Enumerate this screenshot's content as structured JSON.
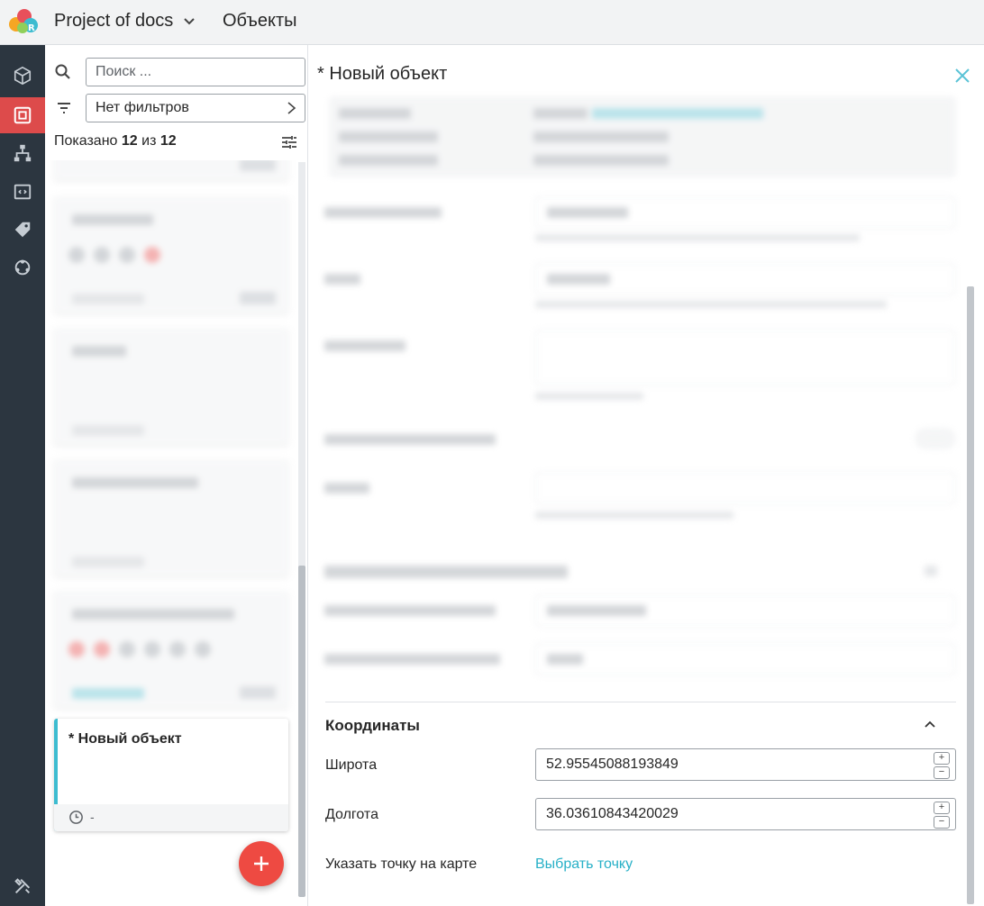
{
  "header": {
    "project_name": "Project of docs",
    "section_title": "Объекты"
  },
  "rail": {
    "items": [
      "objects-cube",
      "devices",
      "hierarchy",
      "code",
      "tags",
      "integrations",
      "tools"
    ],
    "active": "devices"
  },
  "list": {
    "search_placeholder": "Поиск ...",
    "filter_label": "Нет фильтров",
    "shown_prefix": "Показано",
    "shown_count": "12",
    "shown_mid": "из",
    "shown_total": "12",
    "new_card": {
      "title": "* Новый объект",
      "time": "-"
    }
  },
  "detail": {
    "title": "* Новый объект",
    "coordinates": {
      "section_title": "Координаты",
      "latitude_label": "Широта",
      "latitude_value": "52.95545088193849",
      "longitude_label": "Долгота",
      "longitude_value": "36.03610843420029",
      "map_point_label": "Указать точку на карте",
      "map_point_link": "Выбрать точку",
      "step_plus": "+",
      "step_minus": "−"
    }
  },
  "colors": {
    "rail_bg": "#2c3640",
    "rail_active": "#dd4b4b",
    "accent_cyan": "#27b0c7",
    "fab_red": "#ee4a42"
  }
}
